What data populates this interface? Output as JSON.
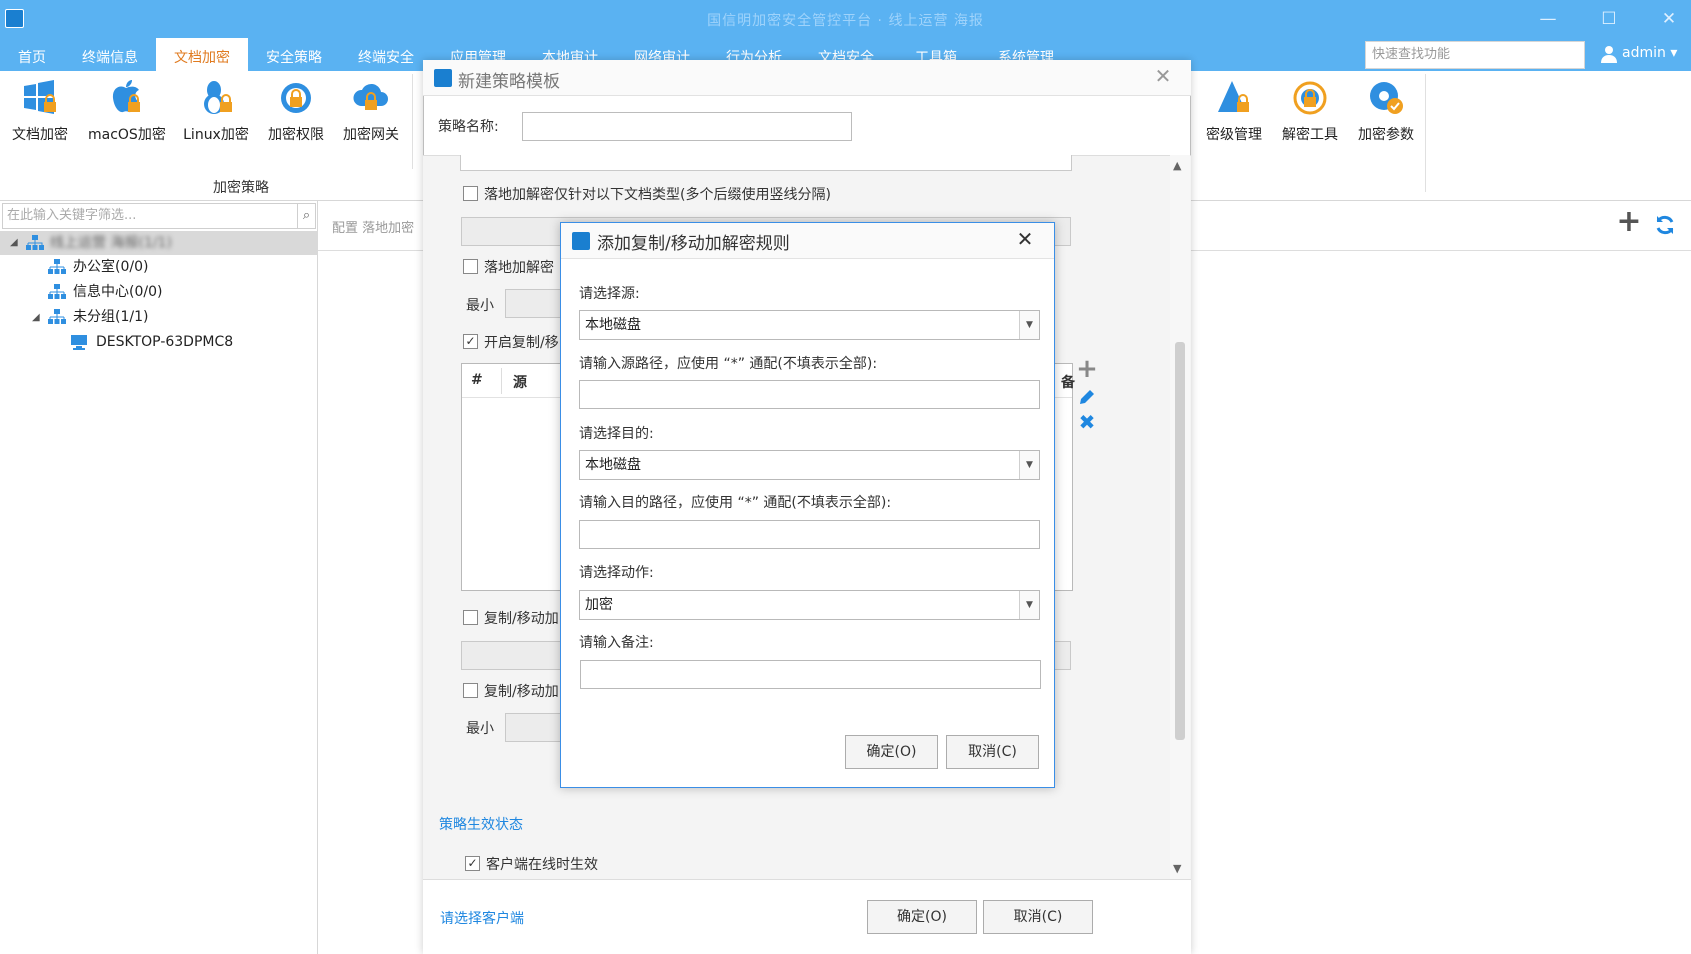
{
  "titlebar": {
    "title": "国信明加密安全管控平台 · 线上运营 海报",
    "min": "—",
    "max": "☐",
    "close": "✕"
  },
  "menu": {
    "tabs": [
      "首页",
      "终端信息",
      "文档加密",
      "安全策略",
      "终端安全",
      "应用管理",
      "本地审计",
      "网络审计",
      "行为分析",
      "文档安全",
      "工具箱",
      "系统管理"
    ],
    "search_placeholder": "快速查找功能",
    "user": "admin ▾"
  },
  "toolbar": {
    "buttons": [
      "文档加密",
      "macOS加密",
      "Linux加密",
      "加密权限",
      "加密网关"
    ],
    "right_buttons": [
      "密级管理",
      "解密工具",
      "加密参数"
    ],
    "group_label": "加密策略"
  },
  "left": {
    "filter_placeholder": "在此输入关键字筛选...",
    "tree": {
      "root": "线上运营 海报(1/1)",
      "children": [
        "办公室(0/0)",
        "信息中心(0/0)",
        "未分组(1/1)"
      ],
      "device": "DESKTOP-63DPMC8"
    }
  },
  "main": {
    "breadcrumb": "配置 落地加密"
  },
  "modal1": {
    "title": "新建策略模板",
    "name_label": "策略名称:",
    "opt1": "落地加解密仅针对以下文档类型(多个后缀使用竖线分隔)",
    "opt2": "落地加解密",
    "min_label1": "最小",
    "opt3": "开启复制/移",
    "table_col1": "#",
    "table_col2": "源",
    "table_col_last": "备",
    "opt4": "复制/移动加",
    "opt5": "复制/移动加",
    "min_label2": "最小",
    "section_title": "策略生效状态",
    "online_label": "客户端在线时生效",
    "select_client": "请选择客户端",
    "ok": "确定(O)",
    "cancel": "取消(C)"
  },
  "modal2": {
    "title": "添加复制/移动加解密规则",
    "src_label": "请选择源:",
    "src_value": "本地磁盘",
    "src_path_label": "请输入源路径，应使用 “*” 通配(不填表示全部):",
    "dst_label": "请选择目的:",
    "dst_value": "本地磁盘",
    "dst_path_label": "请输入目的路径，应使用 “*” 通配(不填表示全部):",
    "action_label": "请选择动作:",
    "action_value": "加密",
    "note_label": "请输入备注:",
    "ok": "确定(O)",
    "cancel": "取消(C)"
  },
  "colors": {
    "accent": "#5ab2f2",
    "active_tab": "#e07b20",
    "link": "#1f87e0",
    "dialog_border": "#3a8ee6"
  }
}
